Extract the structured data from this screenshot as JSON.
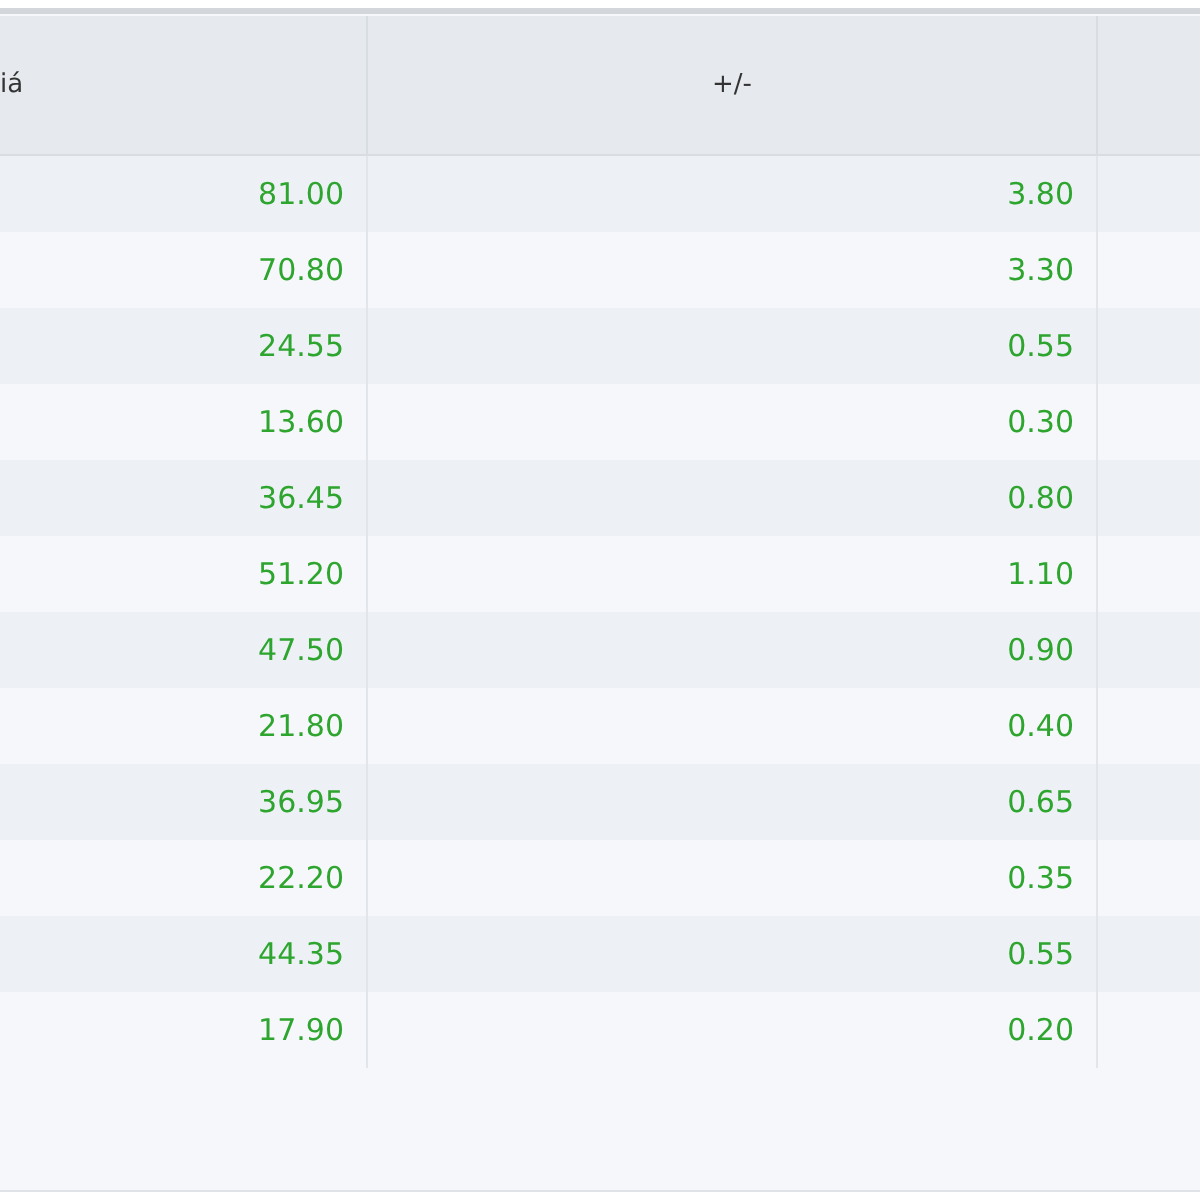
{
  "table": {
    "columns": [
      "iá",
      "+/-"
    ],
    "rows": [
      {
        "price": "81.00",
        "change": "3.80"
      },
      {
        "price": "70.80",
        "change": "3.30"
      },
      {
        "price": "24.55",
        "change": "0.55"
      },
      {
        "price": "13.60",
        "change": "0.30"
      },
      {
        "price": "36.45",
        "change": "0.80"
      },
      {
        "price": "51.20",
        "change": "1.10"
      },
      {
        "price": "47.50",
        "change": "0.90"
      },
      {
        "price": "21.80",
        "change": "0.40"
      },
      {
        "price": "36.95",
        "change": "0.65"
      },
      {
        "price": "22.20",
        "change": "0.35"
      },
      {
        "price": "44.35",
        "change": "0.55"
      },
      {
        "price": "17.90",
        "change": "0.20"
      }
    ]
  }
}
